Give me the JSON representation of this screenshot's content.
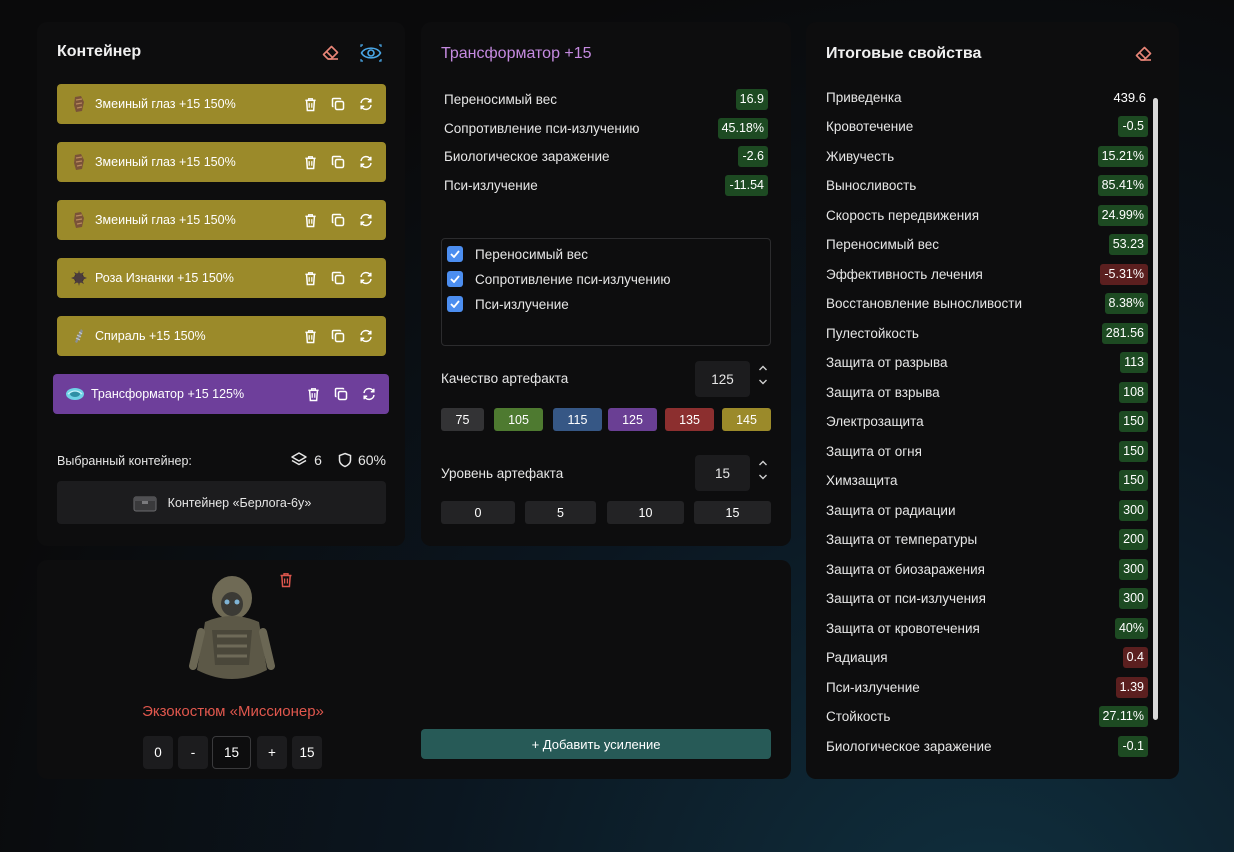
{
  "container_panel": {
    "title": "Контейнер",
    "items": [
      {
        "name": "Змеиный глаз",
        "level": "+15",
        "quality": "150%"
      },
      {
        "name": "Змеиный глаз",
        "level": "+15",
        "quality": "150%"
      },
      {
        "name": "Змеиный глаз",
        "level": "+15",
        "quality": "150%"
      },
      {
        "name": "Роза Изнанки",
        "level": "+15",
        "quality": "150%"
      },
      {
        "name": "Спираль",
        "level": "+15",
        "quality": "150%"
      },
      {
        "name": "Трансформатор",
        "level": "+15",
        "quality": "125%"
      }
    ],
    "selected_label": "Выбранный контейнер:",
    "slots": "6",
    "protection": "60%",
    "container_name": "Контейнер «Берлога-6у»"
  },
  "artifact_panel": {
    "title": "Трансформатор +15",
    "properties": [
      {
        "label": "Переносимый вес",
        "value": "16.9",
        "tone": "g"
      },
      {
        "label": "Сопротивление пси-излучению",
        "value": "45.18%",
        "tone": "g"
      },
      {
        "label": "Биологическое заражение",
        "value": "-2.6",
        "tone": "g"
      },
      {
        "label": "Пси-излучение",
        "value": "-11.54",
        "tone": "g"
      }
    ],
    "checked": [
      "Переносимый вес",
      "Сопротивление пси-излучению",
      "Пси-излучение"
    ],
    "quality_label": "Качество артефакта",
    "quality_value": "125",
    "quality_options": [
      {
        "label": "75",
        "color": "#333335"
      },
      {
        "label": "105",
        "color": "#4e7a30"
      },
      {
        "label": "115",
        "color": "#365785"
      },
      {
        "label": "125",
        "color": "#6a3f94"
      },
      {
        "label": "135",
        "color": "#8c2f2f"
      },
      {
        "label": "145",
        "color": "#9b8a2a"
      }
    ],
    "level_label": "Уровень артефакта",
    "level_value": "15",
    "level_options": [
      "0",
      "5",
      "10",
      "15"
    ]
  },
  "suit_panel": {
    "name": "Экзокостюм «Миссионер»",
    "controls": {
      "min": "0",
      "minus": "-",
      "value": "15",
      "plus": "+",
      "max": "15"
    },
    "add_button": "+ Добавить усиление"
  },
  "totals_panel": {
    "title": "Итоговые свойства",
    "rows": [
      {
        "label": "Приведенка",
        "value": "439.6",
        "tone": "plain"
      },
      {
        "label": "Кровотечение",
        "value": "-0.5",
        "tone": "g"
      },
      {
        "label": "Живучесть",
        "value": "15.21%",
        "tone": "g"
      },
      {
        "label": "Выносливость",
        "value": "85.41%",
        "tone": "g"
      },
      {
        "label": "Скорость передвижения",
        "value": "24.99%",
        "tone": "g"
      },
      {
        "label": "Переносимый вес",
        "value": "53.23",
        "tone": "g"
      },
      {
        "label": "Эффективность лечения",
        "value": "-5.31%",
        "tone": "r"
      },
      {
        "label": "Восстановление выносливости",
        "value": "8.38%",
        "tone": "g"
      },
      {
        "label": "Пулестойкость",
        "value": "281.56",
        "tone": "g"
      },
      {
        "label": "Защита от разрыва",
        "value": "113",
        "tone": "g"
      },
      {
        "label": "Защита от взрыва",
        "value": "108",
        "tone": "g"
      },
      {
        "label": "Электрозащита",
        "value": "150",
        "tone": "g"
      },
      {
        "label": "Защита от огня",
        "value": "150",
        "tone": "g"
      },
      {
        "label": "Химзащита",
        "value": "150",
        "tone": "g"
      },
      {
        "label": "Защита от радиации",
        "value": "300",
        "tone": "g"
      },
      {
        "label": "Защита от температуры",
        "value": "200",
        "tone": "g"
      },
      {
        "label": "Защита от биозаражения",
        "value": "300",
        "tone": "g"
      },
      {
        "label": "Защита от пси-излучения",
        "value": "300",
        "tone": "g"
      },
      {
        "label": "Защита от кровотечения",
        "value": "40%",
        "tone": "g"
      },
      {
        "label": "Радиация",
        "value": "0.4",
        "tone": "r"
      },
      {
        "label": "Пси-излучение",
        "value": "1.39",
        "tone": "r"
      },
      {
        "label": "Стойкость",
        "value": "27.11%",
        "tone": "g"
      },
      {
        "label": "Биологическое заражение",
        "value": "-0.1",
        "tone": "g"
      }
    ]
  },
  "colors": {
    "accent_purple": "#c58ae0",
    "suit_red": "#e0574d",
    "eraser_pink": "#e88577",
    "eye_blue": "#4aa8e8"
  },
  "icons": [
    "eraser-icon",
    "eye-icon",
    "trash-icon",
    "copy-icon",
    "refresh-icon",
    "layers-icon",
    "shield-icon",
    "chevron-up-icon",
    "chevron-down-icon",
    "check-icon"
  ]
}
